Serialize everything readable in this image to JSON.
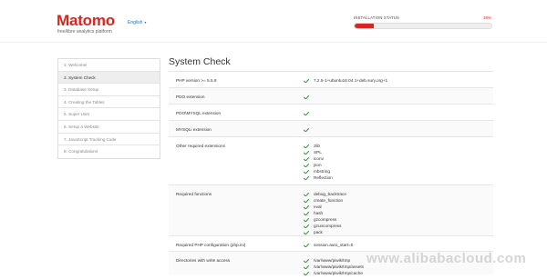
{
  "header": {
    "logo": "Matomo",
    "tagline": "free/libre analytics platform",
    "language": "English",
    "status_label": "INSTALLATION STATUS",
    "status_percent": "38%",
    "progress_fraction": 0.14
  },
  "sidebar": {
    "items": [
      {
        "label": "1. Welcome!"
      },
      {
        "label": "2. System Check"
      },
      {
        "label": "3. Database Setup"
      },
      {
        "label": "4. Creating the Tables"
      },
      {
        "label": "5. Super User"
      },
      {
        "label": "6. Setup a Website"
      },
      {
        "label": "7. JavaScript Tracking Code"
      },
      {
        "label": "8. Congratulations"
      }
    ],
    "active_index": 1
  },
  "main": {
    "title": "System Check",
    "rows": [
      {
        "label": "PHP version >= 5.5.9",
        "values": [
          "7.2.5-1+ubuntu16.04.1+deb.sury.org+1"
        ]
      },
      {
        "label": "PDO extension",
        "values": [
          ""
        ]
      },
      {
        "label": "PDO\\MYSQL extension",
        "values": [
          ""
        ]
      },
      {
        "label": "MYSQLi extension",
        "values": [
          ""
        ]
      },
      {
        "label": "Other required extensions",
        "values": [
          "zlib",
          "SPL",
          "iconv",
          "json",
          "mbstring",
          "Reflection"
        ]
      },
      {
        "label": "Required functions",
        "values": [
          "debug_backtrace",
          "create_function",
          "eval",
          "hash",
          "gzcompress",
          "gzuncompress",
          "pack"
        ]
      },
      {
        "label": "Required PHP configuration (php.ini)",
        "values": [
          "session.auto_start=0"
        ]
      },
      {
        "label": "Directories with write access",
        "values": [
          "/var/www/piwik/tmp",
          "/var/www/piwik/tmp/assets",
          "/var/www/piwik/tmp/cache"
        ]
      }
    ]
  },
  "watermark": "www.alibabacloud.com",
  "colors": {
    "brand": "#d4291f",
    "check": "#3c9f48",
    "link": "#1a73c9"
  },
  "icons": {
    "check": "check-icon",
    "caret": "caret-down-icon"
  }
}
